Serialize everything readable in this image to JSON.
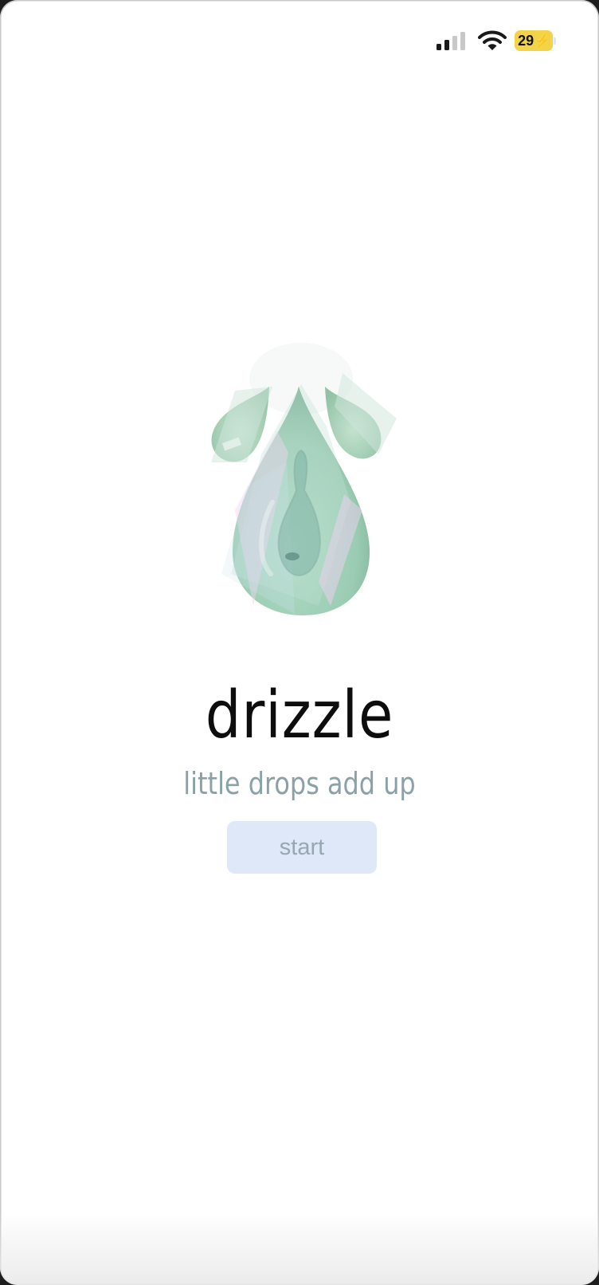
{
  "status_bar": {
    "battery_level": "29",
    "battery_charging_symbol": "⚡",
    "battery_color": "#f3d34a",
    "signal_icon": "cellular-signal-icon",
    "wifi_icon": "wifi-icon"
  },
  "splash": {
    "logo_icon": "drizzle-raindrop-logo",
    "title": "drizzle",
    "tagline": "little drops add up",
    "start_label": "start"
  },
  "colors": {
    "title": "#0d0d0d",
    "tagline": "#8aa1a6",
    "start_button_bg": "#dfe8f8",
    "start_button_text": "#98a6b1",
    "drop_green": "#8fc9a6"
  }
}
